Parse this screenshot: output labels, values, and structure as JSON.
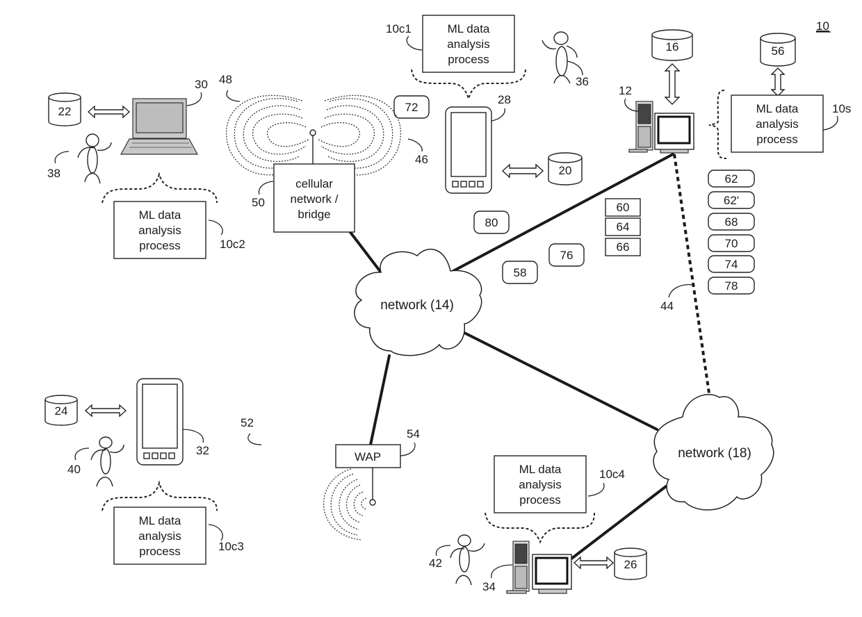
{
  "figure": {
    "reference": "10",
    "process_label_lines": [
      "ML data",
      "analysis",
      "process"
    ],
    "processes": {
      "c1": "10c1",
      "c2": "10c2",
      "c3": "10c3",
      "c4": "10c4",
      "server": "10s"
    },
    "networks": {
      "n14": "network (14)",
      "n18": "network (18)"
    },
    "cellular_bridge_lines": [
      "cellular",
      "network /",
      "bridge"
    ],
    "wap_label": "WAP",
    "refs": {
      "server_computer": "12",
      "storage_16": "16",
      "storage_56": "56",
      "storage_20": "20",
      "storage_22": "22",
      "storage_24": "24",
      "storage_26": "26",
      "smartphone_28": "28",
      "laptop_30": "30",
      "smartphone_32": "32",
      "desktop_34": "34",
      "user_36": "36",
      "user_38": "38",
      "user_40": "40",
      "user_42": "42",
      "link_44": "44",
      "link_46": "46",
      "link_48": "48",
      "bridge_50": "50",
      "link_52": "52",
      "wap_54": "54"
    },
    "square_tags": [
      "60",
      "64",
      "66"
    ],
    "rounded_tags_column": [
      "62",
      "62'",
      "68",
      "70",
      "74",
      "78"
    ],
    "floating_tags": {
      "t72": "72",
      "t80": "80",
      "t76": "76",
      "t58": "58"
    }
  }
}
